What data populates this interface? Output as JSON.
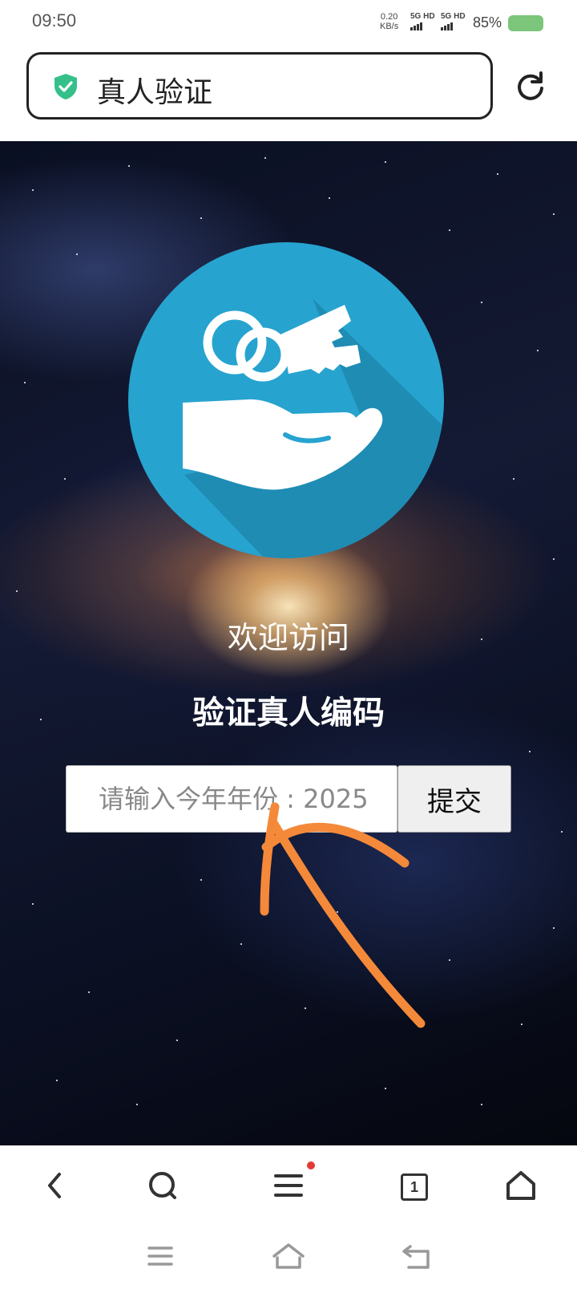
{
  "status_bar": {
    "time": "09:50",
    "net_speed_value": "0.20",
    "net_speed_unit": "KB/s",
    "sim1_label": "5G HD",
    "sim2_label": "5G HD",
    "battery_percent": "85%",
    "battery_color": "#7bc67b"
  },
  "address_bar": {
    "secure_icon": "shield-check-icon",
    "title": "真人验证",
    "reload_icon": "reload-icon"
  },
  "page": {
    "logo_icon": "keys-in-hand-icon",
    "logo_color": "#27a3cf",
    "welcome_text": "欢迎访问",
    "heading": "验证真人编码",
    "input_placeholder": "请输入今年年份 : 2025",
    "input_value": "",
    "submit_label": "提交",
    "annotation": "orange-hand-drawn-arrow",
    "annotation_color": "#f5893a"
  },
  "toolbar": {
    "items": [
      "back-icon",
      "search-icon",
      "menu-icon",
      "tabs-icon",
      "home-icon"
    ],
    "tab_count": "1",
    "menu_has_notification": true
  },
  "system_nav": {
    "items": [
      "recents-icon",
      "home-icon",
      "back-icon"
    ]
  }
}
